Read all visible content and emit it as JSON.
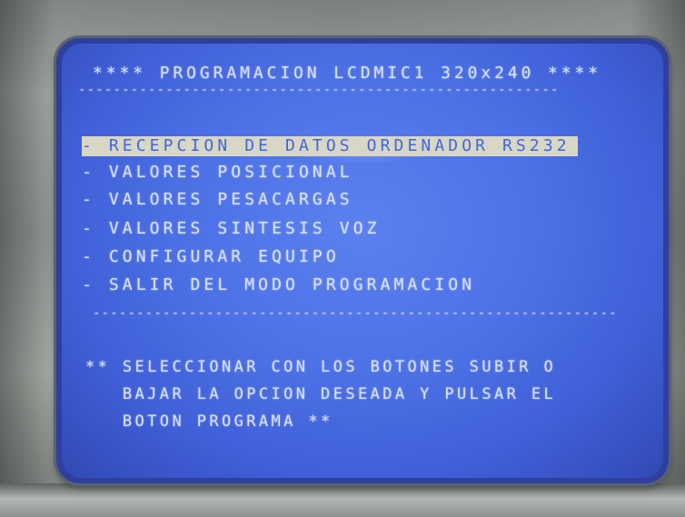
{
  "screen": {
    "title": "**** PROGRAMACION LCDMIC1 320x240 ****",
    "top_divider": "-------------------------------------------------------",
    "menu_items": [
      "- RECEPCION DE DATOS ORDENADOR RS232",
      "- VALORES POSICIONAL",
      "- VALORES PESACARGAS",
      "- VALORES SINTESIS VOZ",
      "- CONFIGURAR EQUIPO",
      "- SALIR DEL MODO PROGRAMACION"
    ],
    "bottom_divider": "------------------------------------------------------------",
    "instructions": [
      "** SELECCIONAR CON LOS BOTONES SUBIR O",
      "   BAJAR LA OPCION DESEADA Y PULSAR EL",
      "   BOTON PROGRAMA **"
    ]
  },
  "colors": {
    "screen_blue": "#4d72e6",
    "lcd_text": "#d9e2ff",
    "selection_bar": "#d8d6c4",
    "bezel": "#9ea39f"
  }
}
